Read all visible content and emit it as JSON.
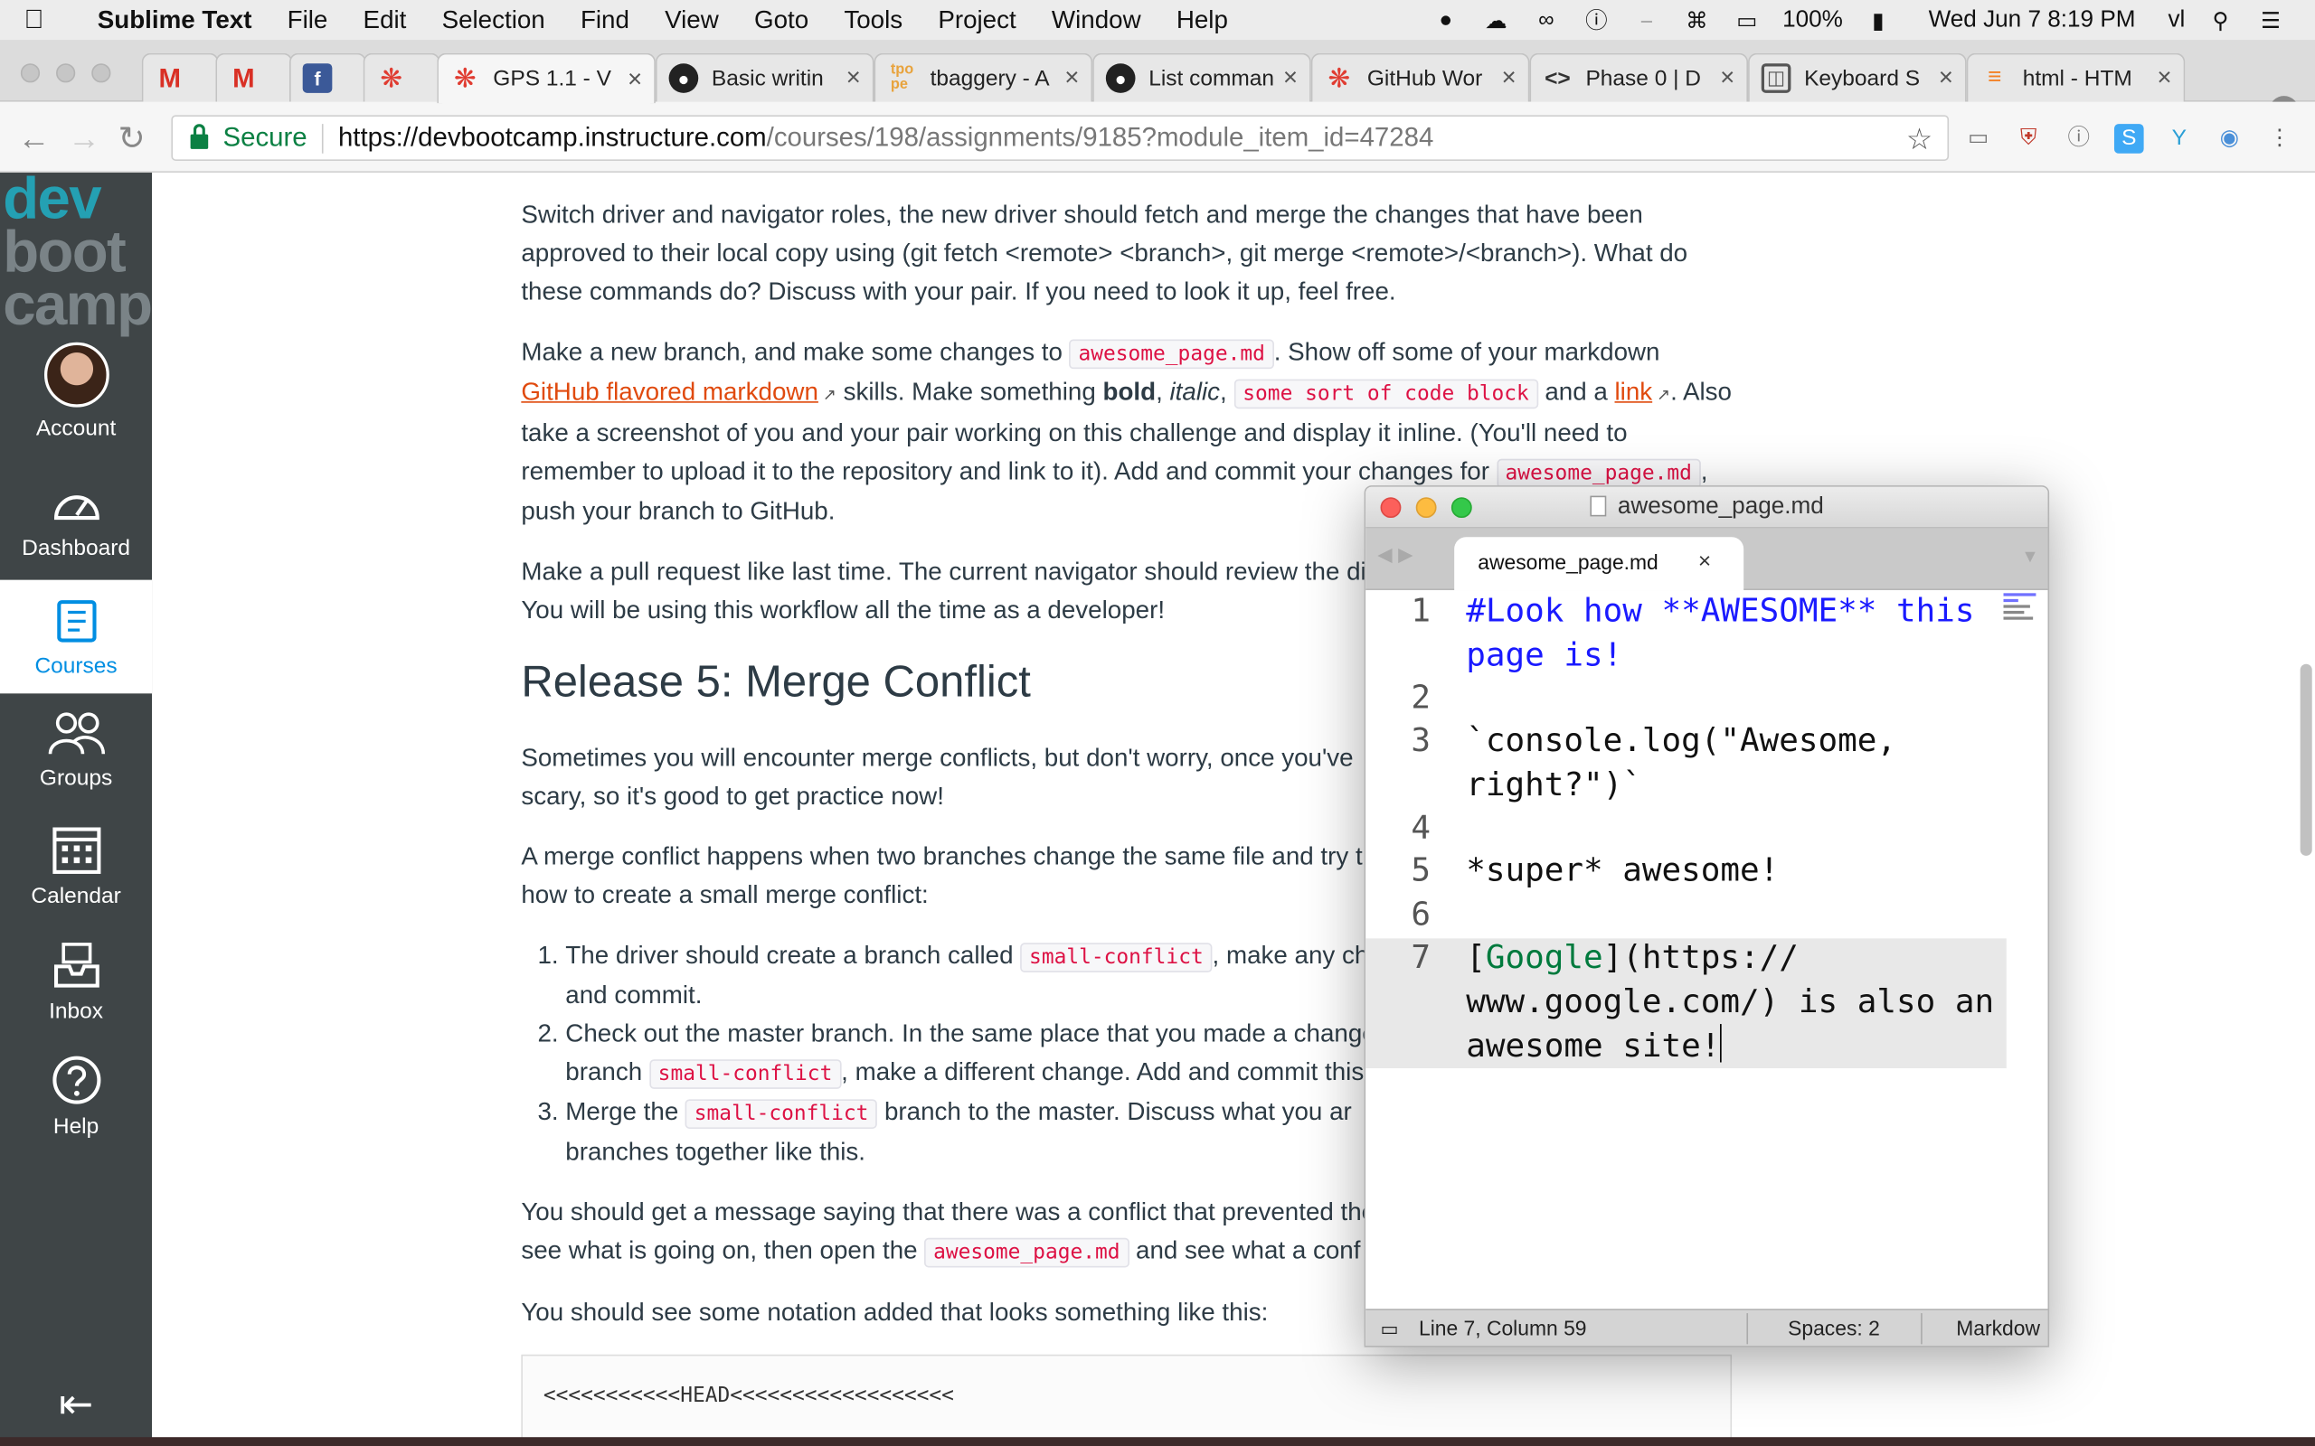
{
  "menubar": {
    "app_name": "Sublime Text",
    "items": [
      "File",
      "Edit",
      "Selection",
      "Find",
      "View",
      "Goto",
      "Tools",
      "Project",
      "Window",
      "Help"
    ],
    "battery": "100%",
    "clock": "Wed Jun 7  8:19 PM",
    "user": "vl"
  },
  "tabs": [
    {
      "title": "",
      "icon": "gmail-icon",
      "color": "#d93025"
    },
    {
      "title": "",
      "icon": "gmail-icon",
      "color": "#d93025"
    },
    {
      "title": "",
      "icon": "facebook-icon",
      "color": "#3b5998"
    },
    {
      "title": "",
      "icon": "canvas-icon",
      "color": "#e03c31"
    },
    {
      "title": "GPS 1.1 - V",
      "icon": "canvas-icon",
      "color": "#e03c31"
    },
    {
      "title": "Basic writin",
      "icon": "github-icon",
      "color": "#222222"
    },
    {
      "title": "tbaggery - A",
      "icon": "tpope-icon",
      "color": "#e8a33d"
    },
    {
      "title": "List comman",
      "icon": "github-icon",
      "color": "#222222"
    },
    {
      "title": "GitHub Wor",
      "icon": "canvas-icon",
      "color": "#e03c31"
    },
    {
      "title": "Phase 0 | D",
      "icon": "code-icon",
      "color": "#333333"
    },
    {
      "title": "Keyboard S",
      "icon": "book-icon",
      "color": "#555555"
    },
    {
      "title": "html - HTM",
      "icon": "stackoverflow-icon",
      "color": "#f48024"
    }
  ],
  "address": {
    "secure_label": "Secure",
    "url_host": "https://devbootcamp.instructure.com",
    "url_path": "/courses/198/assignments/9185?module_item_id=47284"
  },
  "sidebar": {
    "logo": [
      "dev",
      "boot",
      "camp"
    ],
    "items": [
      {
        "label": "Account",
        "icon": "avatar"
      },
      {
        "label": "Dashboard",
        "icon": "dashboard-icon"
      },
      {
        "label": "Courses",
        "icon": "courses-icon",
        "active": true
      },
      {
        "label": "Groups",
        "icon": "groups-icon"
      },
      {
        "label": "Calendar",
        "icon": "calendar-icon"
      },
      {
        "label": "Inbox",
        "icon": "inbox-icon"
      },
      {
        "label": "Help",
        "icon": "help-icon"
      }
    ],
    "collapse_icon": "collapse-icon"
  },
  "article": {
    "p1": "Switch driver and navigator roles, the new driver should fetch and merge the changes that have been approved to their local copy using (git fetch <remote> <branch>, git merge <remote>/<branch>). What do these commands do? Discuss with your pair. If you need to look it up, feel free.",
    "p2_a": "Make a new branch, and make some changes to ",
    "p2_code1": "awesome_page.md",
    "p2_b": ". Show off some of your markdown ",
    "p2_link1": "GitHub flavored markdown",
    "p2_c": " skills. Make something ",
    "p2_bold": "bold",
    "p2_d": ", ",
    "p2_italic": "italic",
    "p2_e": ", ",
    "p2_code2": "some sort of code block",
    "p2_f": " and a ",
    "p2_link2": "link",
    "p2_g": ". Also take a screenshot of you and your pair working on this challenge and display it inline. (You'll need to remember to upload it to the repository and link to it). Add and commit your changes for ",
    "p2_code3": "awesome_page.md",
    "p2_h": ", push your branch to GitHub.",
    "p3": "Make a pull request like last time. The current navigator should review the di... You will be using this workflow all the time as a developer!",
    "p3_a": "Make a pull request like last time. The current navigator should review the di",
    "p3_b": "You will be using this workflow all the time as a developer!",
    "heading": "Release 5: Merge Conflict",
    "p4_a": "Sometimes you will encounter merge conflicts, but don't worry, once you've",
    "p4_b": "scary, so it's good to get practice now!",
    "p5_a": "A merge conflict happens when two branches change the same file and try t",
    "p5_b": "how to create a small merge conflict:",
    "li1_a": "The driver should create a branch called ",
    "li1_code": "small-conflict",
    "li1_b": ", make any ch",
    "li1_c": "and commit.",
    "li2_a": "Check out the master branch. In the same place that you made a change",
    "li2_b": "branch ",
    "li2_code": "small-conflict",
    "li2_c": ", make a different change. Add and commit this",
    "li3_a": "Merge the ",
    "li3_code": "small-conflict",
    "li3_b": " branch to the master. Discuss what you ar",
    "li3_c": "branches together like this.",
    "p6_a": "You should get a message saying that there was a conflict that prevented the",
    "p6_b": "see what is going on, then open the ",
    "p6_code": "awesome_page.md",
    "p6_c": " and see what a conf",
    "p7": "You should see some notation added that looks something like this:",
    "pre": "<<<<<<<<<<<HEAD<<<<<<<<<<<<<<<<<<"
  },
  "sublime": {
    "window_title": "awesome_page.md",
    "tab_title": "awesome_page.md",
    "lines": [
      {
        "num": "1",
        "text": "#Look how **AWESOME** this",
        "style": "header"
      },
      {
        "num": "",
        "text": "page is!",
        "style": "header"
      },
      {
        "num": "2",
        "text": "",
        "style": ""
      },
      {
        "num": "3",
        "text": "`console.log(\"Awesome,",
        "style": ""
      },
      {
        "num": "",
        "text": "right?\")`",
        "style": ""
      },
      {
        "num": "4",
        "text": "",
        "style": ""
      },
      {
        "num": "5",
        "text": "*super* awesome!",
        "style": ""
      },
      {
        "num": "6",
        "text": "",
        "style": ""
      },
      {
        "num": "7",
        "text": "[Google](https://",
        "style": "link"
      },
      {
        "num": "",
        "text": "www.google.com/) is also an",
        "style": ""
      },
      {
        "num": "",
        "text": "awesome site!",
        "style": "cursor"
      }
    ],
    "link_text": "Google",
    "status_position": "Line 7, Column 59",
    "status_indent": "Spaces: 2",
    "status_syntax": "Markdow"
  }
}
